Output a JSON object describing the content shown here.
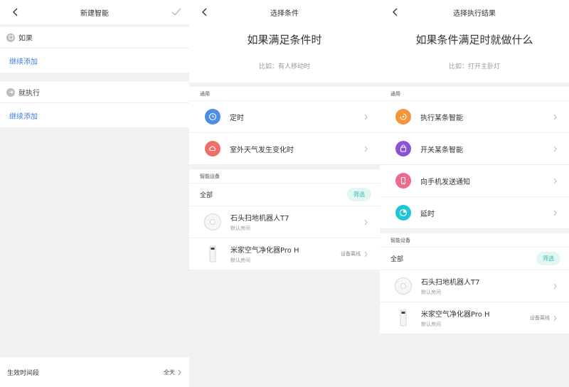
{
  "panel1": {
    "title": "新建智能",
    "if_label": "如果",
    "if_add": "继续添加",
    "then_label": "就执行",
    "then_add": "继续添加",
    "footer_label": "生效时间段",
    "footer_value": "全天"
  },
  "panel2": {
    "title": "选择条件",
    "heading": "如果满足条件时",
    "hint": "比如：有人移动时",
    "group_general": "通用",
    "items": [
      {
        "label": "定时",
        "icon": "clock-icon",
        "color": "#4e8de6"
      },
      {
        "label": "室外天气发生变化时",
        "icon": "weather-icon",
        "color": "#f06f6b"
      }
    ],
    "group_devices": "智能设备",
    "filter_all": "全部",
    "filter_button": "筛选",
    "devices": [
      {
        "name": "石头扫地机器人T7",
        "room": "默认房间",
        "status": ""
      },
      {
        "name": "米家空气净化器Pro H",
        "room": "默认房间",
        "status": "设备离线"
      }
    ]
  },
  "panel3": {
    "title": "选择执行结果",
    "heading": "如果条件满足时就做什么",
    "hint": "比如：打开主卧灯",
    "group_general": "通用",
    "items": [
      {
        "label": "执行某条智能",
        "icon": "run-scene-icon",
        "color": "#f5953a"
      },
      {
        "label": "开关某条智能",
        "icon": "toggle-scene-icon",
        "color": "#8b52d6"
      },
      {
        "label": "向手机发送通知",
        "icon": "phone-notify-icon",
        "color": "#ee6a8c"
      },
      {
        "label": "延时",
        "icon": "delay-icon",
        "color": "#21c6d6"
      }
    ],
    "group_devices": "智能设备",
    "filter_all": "全部",
    "filter_button": "筛选",
    "devices": [
      {
        "name": "石头扫地机器人T7",
        "room": "默认房间",
        "status": ""
      },
      {
        "name": "米家空气净化器Pro H",
        "room": "默认房间",
        "status": "设备离线"
      }
    ]
  }
}
